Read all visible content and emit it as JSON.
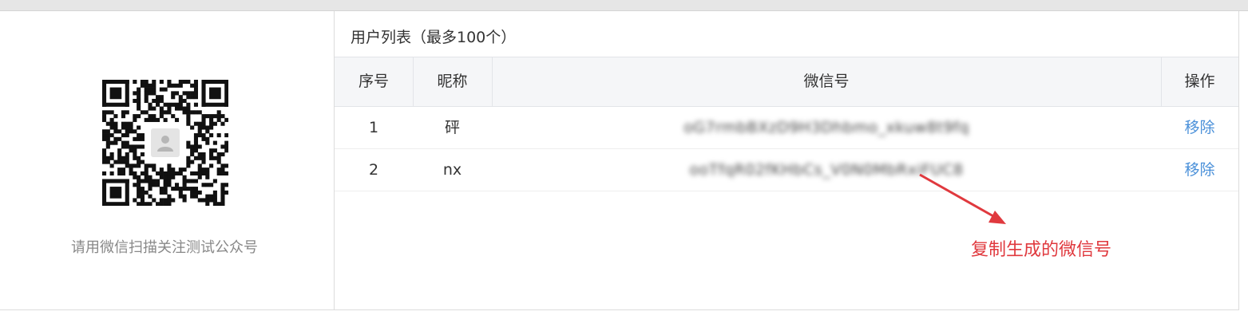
{
  "left_panel": {
    "caption": "请用微信扫描关注测试公众号",
    "qr_icon": "qr-code-icon",
    "avatar_icon": "user-avatar-icon"
  },
  "user_list": {
    "title": "用户列表（最多100个）",
    "columns": [
      "序号",
      "昵称",
      "微信号",
      "操作"
    ],
    "rows": [
      {
        "index": "1",
        "nickname": "砰",
        "wechat_id": "oG7rmbBXzD9H3Dhbmo_xkuw8t9fq",
        "action": "移除"
      },
      {
        "index": "2",
        "nickname": "nx",
        "wechat_id": "ooTfqR02fKHbCs_V0N0MbRxiFUC8",
        "action": "移除"
      }
    ]
  },
  "annotation": {
    "text": "复制生成的微信号",
    "color": "#e0393e",
    "icon": "red-arrow-icon"
  },
  "colors": {
    "link": "#4a90d9",
    "header_bg": "#f5f6f8",
    "top_bar": "#e6e6e6"
  }
}
